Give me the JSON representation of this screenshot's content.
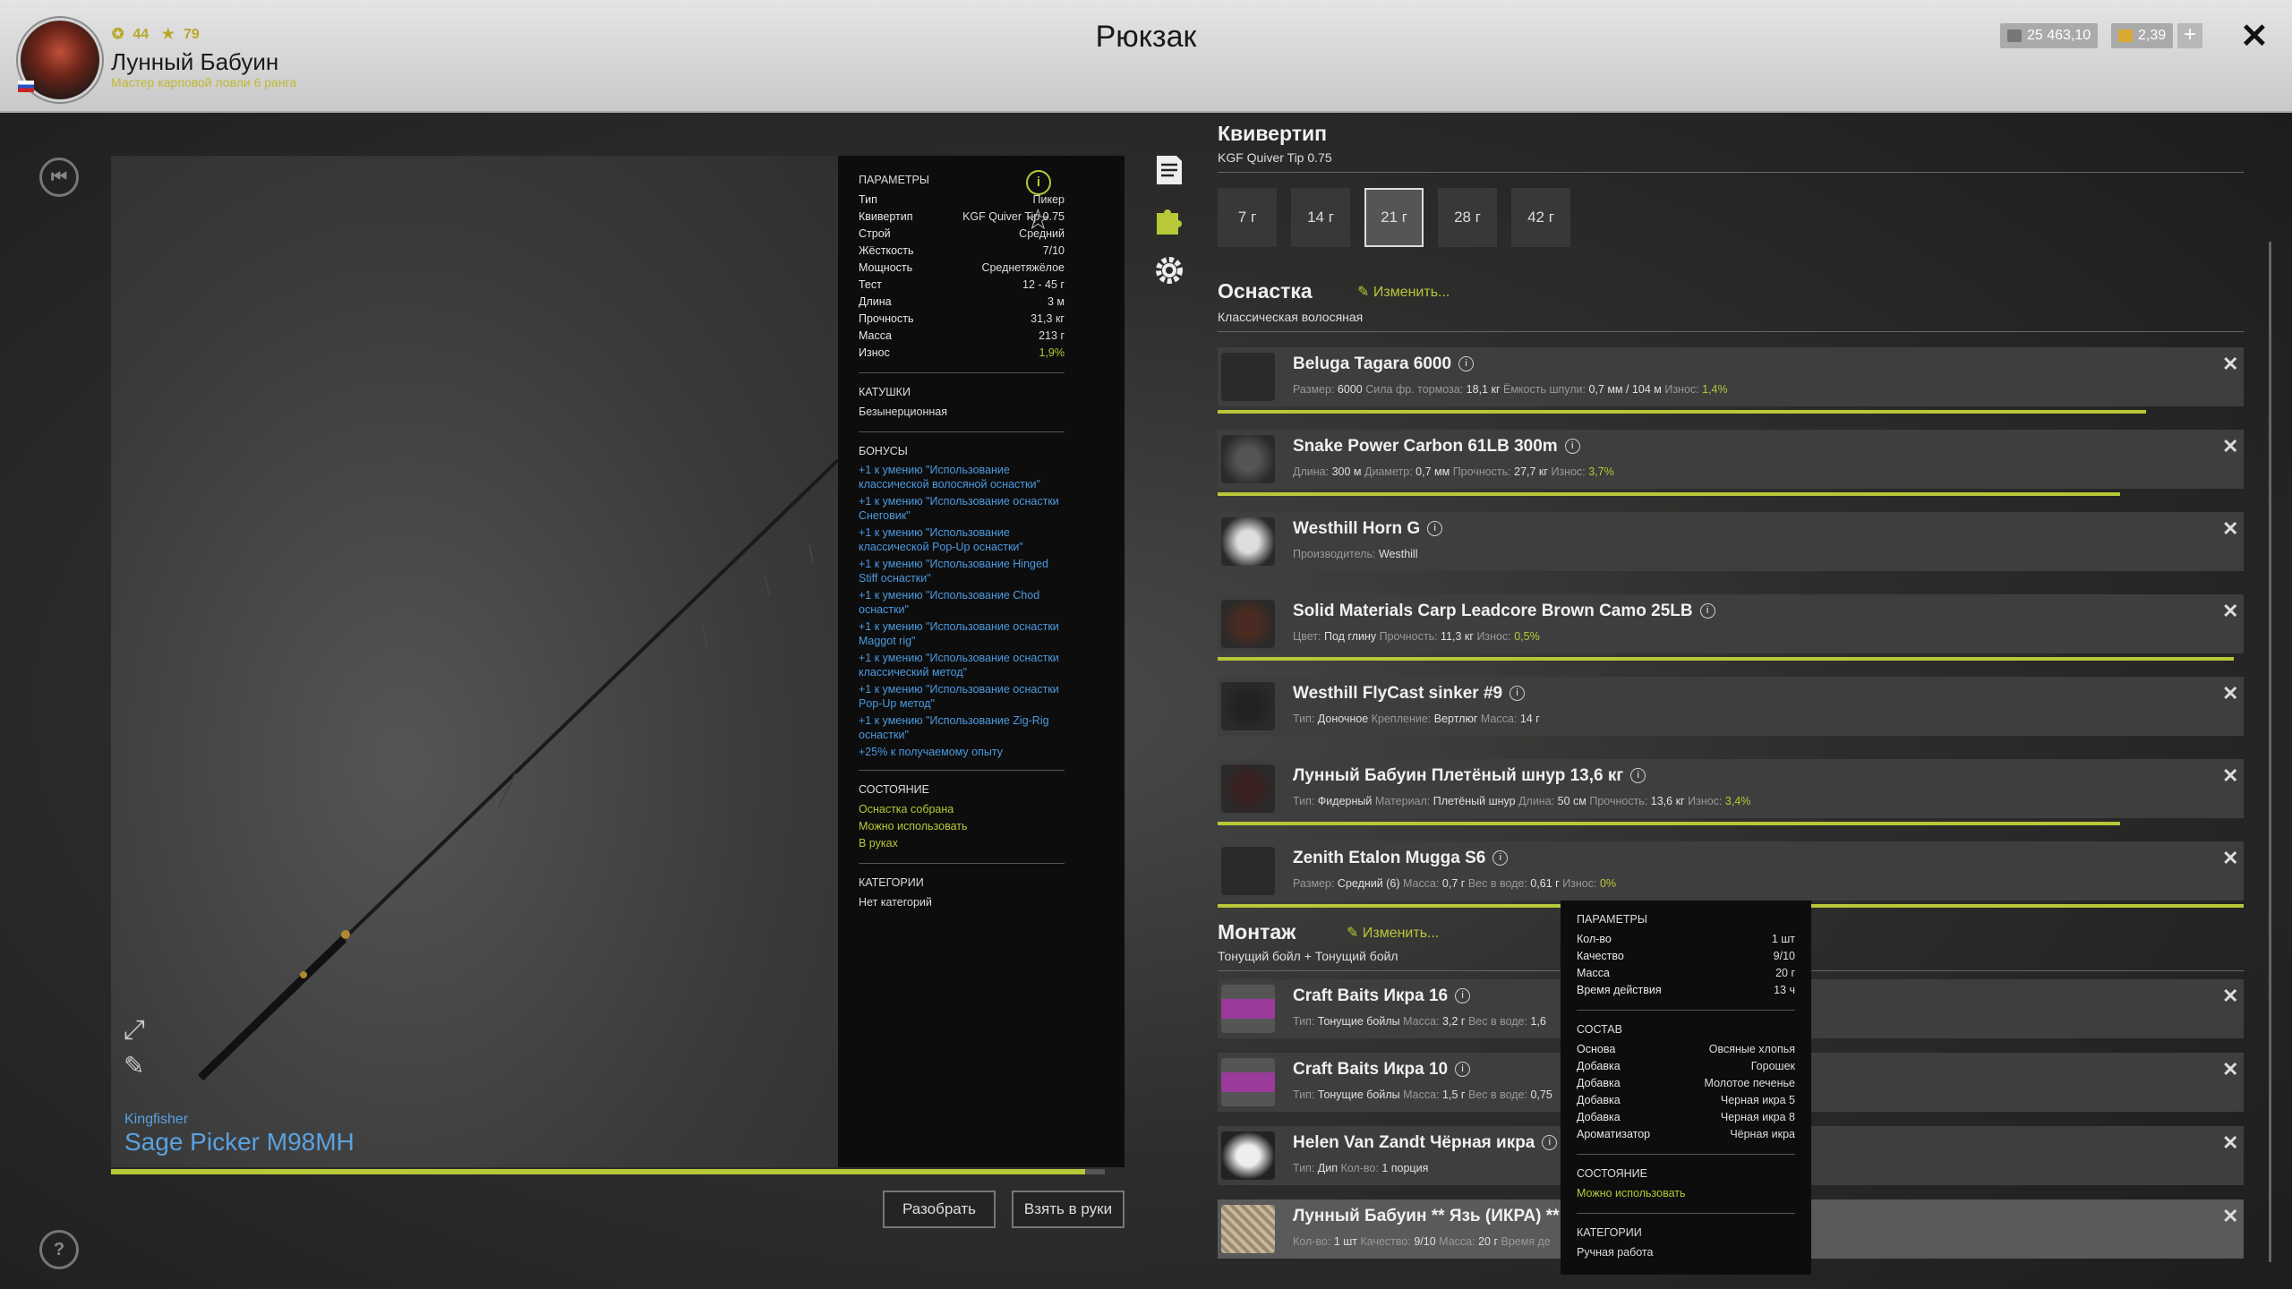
{
  "header": {
    "title": "Рюкзак",
    "player_name": "Лунный Бабуин",
    "player_rank": "Мастер карповой ловли 6 ранга",
    "level": "44",
    "stars": "79",
    "silver": "25 463,10",
    "gold": "2,39",
    "plus": "+",
    "close": "✕"
  },
  "rod": {
    "brand": "Kingfisher",
    "name": "Sage Picker M98MH",
    "wear_fraction": 0.98,
    "disassemble": "Разобрать",
    "take": "Взять в руки"
  },
  "params": {
    "title": "ПАРАМЕТРЫ",
    "rows": [
      {
        "k": "Тип",
        "v": "Пикер"
      },
      {
        "k": "Квивертип",
        "v": "KGF Quiver Tip 0.75"
      },
      {
        "k": "Строй",
        "v": "Средний"
      },
      {
        "k": "Жёсткость",
        "v": "7/10"
      },
      {
        "k": "Мощность",
        "v": "Среднетяжёлое"
      },
      {
        "k": "Тест",
        "v": "12 - 45 г"
      },
      {
        "k": "Длина",
        "v": "3 м"
      },
      {
        "k": "Прочность",
        "v": "31,3 кг"
      },
      {
        "k": "Масса",
        "v": "213 г"
      },
      {
        "k": "Износ",
        "v": "1,9%"
      }
    ],
    "reels_title": "КАТУШКИ",
    "reels_value": "Безынерционная",
    "bonus_title": "БОНУСЫ",
    "bonuses": [
      "+1 к умению \"Использование классической волосяной оснастки\"",
      "+1 к умению \"Использование оснастки Снеговик\"",
      "+1 к умению \"Использование классической Pop-Up оснастки\"",
      "+1 к умению \"Использование Hinged Stiff оснастки\"",
      "+1 к умению \"Использование Chod оснастки\"",
      "+1 к умению \"Использование оснастки Maggot rig\"",
      "+1 к умению \"Использование оснастки классический метод\"",
      "+1 к умению \"Использование оснастки Pop-Up метод\"",
      "+1 к умению \"Использование Zig-Rig оснастки\"",
      "+25% к получаемому опыту"
    ],
    "state_title": "СОСТОЯНИЕ",
    "states": [
      "Оснастка собрана",
      "Можно использовать",
      "В руках"
    ],
    "cat_title": "КАТЕГОРИИ",
    "cat_value": "Нет категорий"
  },
  "quiver": {
    "title": "Квивертип",
    "subtitle": "KGF Quiver Tip 0.75",
    "weights": [
      "7 г",
      "14 г",
      "21 г",
      "28 г",
      "42 г"
    ],
    "selected": 2
  },
  "tackle": {
    "title": "Оснастка",
    "edit": "Изменить...",
    "subtitle": "Классическая волосяная",
    "items": [
      {
        "name": "Beluga Tagara 6000",
        "det": [
          [
            "Размер:",
            "6000"
          ],
          [
            "Сила фр. тормоза:",
            "18,1 кг"
          ],
          [
            "Ёмкость шпули:",
            "0,7 мм / 104 м"
          ],
          [
            "Износ:",
            "1,4%",
            "g"
          ]
        ],
        "bar": 0.905
      },
      {
        "name": "Snake Power Carbon 61LB 300m",
        "det": [
          [
            "Длина:",
            "300 м"
          ],
          [
            "Диаметр:",
            "0,7 мм"
          ],
          [
            "Прочность:",
            "27,7 кг"
          ],
          [
            "Износ:",
            "3,7%",
            "g"
          ]
        ],
        "bar": 0.88
      },
      {
        "name": "Westhill Horn G",
        "det": [
          [
            "Производитель:",
            "Westhill"
          ]
        ],
        "bar": 0
      },
      {
        "name": "Solid Materials Carp Leadcore Brown Camo 25LB",
        "det": [
          [
            "Цвет:",
            "Под глину"
          ],
          [
            "Прочность:",
            "11,3 кг"
          ],
          [
            "Износ:",
            "0,5%",
            "g"
          ]
        ],
        "bar": 0.99
      },
      {
        "name": "Westhill FlyCast sinker #9",
        "det": [
          [
            "Тип:",
            "Доночное"
          ],
          [
            "Крепление:",
            "Вертлюг"
          ],
          [
            "Масса:",
            "14 г"
          ]
        ],
        "bar": 0
      },
      {
        "name": "Лунный Бабуин Плетёный шнур 13,6 кг",
        "det": [
          [
            "Тип:",
            "Фидерный"
          ],
          [
            "Материал:",
            "Плетёный шнур"
          ],
          [
            "Длина:",
            "50 см"
          ],
          [
            "Прочность:",
            "13,6 кг"
          ],
          [
            "Износ:",
            "3,4%",
            "g"
          ]
        ],
        "bar": 0.88
      },
      {
        "name": "Zenith Etalon Mugga S6",
        "det": [
          [
            "Размер:",
            "Средний (6)"
          ],
          [
            "Масса:",
            "0,7 г"
          ],
          [
            "Вес в воде:",
            "0,61 г"
          ],
          [
            "Износ:",
            "0%",
            "g"
          ]
        ],
        "bar": 1.0
      }
    ]
  },
  "rig": {
    "title": "Монтаж",
    "edit": "Изменить...",
    "subtitle": "Тонущий бойл + Тонущий бойл",
    "items": [
      {
        "name": "Craft Baits Икра 16",
        "det": [
          [
            "Тип:",
            "Тонущие бойлы"
          ],
          [
            "Масса:",
            "3,2 г"
          ],
          [
            "Вес в воде:",
            "1,6"
          ]
        ]
      },
      {
        "name": "Craft Baits Икра 10",
        "det": [
          [
            "Тип:",
            "Тонущие бойлы"
          ],
          [
            "Масса:",
            "1,5 г"
          ],
          [
            "Вес в воде:",
            "0,75"
          ]
        ]
      },
      {
        "name": "Helen Van Zandt Чёрная икра",
        "det": [
          [
            "Тип:",
            "Дип"
          ],
          [
            "Кол-во:",
            "1 порция"
          ]
        ]
      },
      {
        "name": "Лунный Бабуин ** Язь (ИКРА) **",
        "det": [
          [
            "Кол-во:",
            "1 шт"
          ],
          [
            "Качество:",
            "9/10"
          ],
          [
            "Масса:",
            "20 г"
          ],
          [
            "Время де",
            ""
          ]
        ]
      }
    ]
  },
  "tooltip": {
    "params_title": "ПАРАМЕТРЫ",
    "params": [
      {
        "k": "Кол-во",
        "v": "1 шт"
      },
      {
        "k": "Качество",
        "v": "9/10"
      },
      {
        "k": "Масса",
        "v": "20 г"
      },
      {
        "k": "Время действия",
        "v": "13 ч"
      }
    ],
    "comp_title": "СОСТАВ",
    "comp": [
      {
        "k": "Основа",
        "v": "Овсяные хлопья"
      },
      {
        "k": "Добавка",
        "v": "Горошек"
      },
      {
        "k": "Добавка",
        "v": "Молотое печенье"
      },
      {
        "k": "Добавка",
        "v": "Черная икра 5"
      },
      {
        "k": "Добавка",
        "v": "Черная икра 8"
      },
      {
        "k": "Ароматизатор",
        "v": "Чёрная икра"
      }
    ],
    "state_title": "СОСТОЯНИЕ",
    "state": "Можно использовать",
    "cat_title": "КАТЕГОРИИ",
    "cat": "Ручная работа"
  },
  "colors": {
    "accent": "#b8c838",
    "link": "#4c9ae0"
  }
}
